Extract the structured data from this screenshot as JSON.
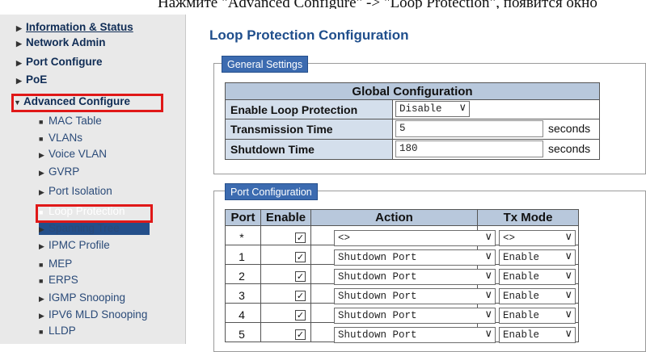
{
  "caption": "Нажмите \"Advanced Configure\" -> \"Loop Protection\", появится окно",
  "sidebar": {
    "items": [
      {
        "label": "Information & Status",
        "expander": "▶",
        "top": true
      },
      {
        "label": "Network Admin",
        "expander": "▶",
        "top": true
      },
      {
        "label": "Port Configure",
        "expander": "▶",
        "top": true
      },
      {
        "label": "PoE",
        "expander": "▶",
        "top": true
      },
      {
        "label": "Advanced Configure",
        "expander": "▼",
        "top": true
      },
      {
        "label": "MAC Table",
        "expander": "■"
      },
      {
        "label": "VLANs",
        "expander": "■"
      },
      {
        "label": "Voice VLAN",
        "expander": "▶"
      },
      {
        "label": "GVRP",
        "expander": "▶"
      },
      {
        "label": "Port Isolation",
        "expander": "▶"
      },
      {
        "label": "Loop Protection",
        "expander": "■"
      },
      {
        "label": "Spanning Tree",
        "expander": "▶"
      },
      {
        "label": "IPMC Profile",
        "expander": "▶"
      },
      {
        "label": "MEP",
        "expander": "■"
      },
      {
        "label": "ERPS",
        "expander": "■"
      },
      {
        "label": "IGMP Snooping",
        "expander": "▶"
      },
      {
        "label": "IPV6 MLD Snooping",
        "expander": "▶"
      },
      {
        "label": "LLDP",
        "expander": "■"
      }
    ],
    "highlight_color": "#e01818",
    "selected_color": "#244f8a"
  },
  "page_title": "Loop Protection Configuration",
  "general": {
    "legend": "General Settings",
    "header": "Global Configuration",
    "rows": [
      {
        "label": "Enable Loop Protection",
        "value": "Disable"
      },
      {
        "label": "Transmission Time",
        "value": "5",
        "unit": "seconds"
      },
      {
        "label": "Shutdown Time",
        "value": "180",
        "unit": "seconds"
      }
    ]
  },
  "port": {
    "legend": "Port Configuration",
    "headers": {
      "port": "Port",
      "enable": "Enable",
      "action": "Action",
      "txmode": "Tx Mode"
    },
    "rows": [
      {
        "port": "*",
        "enable": "checked",
        "action": "<>",
        "txmode": "<>"
      },
      {
        "port": "1",
        "enable": "checked",
        "action": "Shutdown Port",
        "txmode": "Enable"
      },
      {
        "port": "2",
        "enable": "checked",
        "action": "Shutdown Port",
        "txmode": "Enable"
      },
      {
        "port": "3",
        "enable": "checked",
        "action": "Shutdown Port",
        "txmode": "Enable"
      },
      {
        "port": "4",
        "enable": "checked",
        "action": "Shutdown Port",
        "txmode": "Enable"
      },
      {
        "port": "5",
        "enable": "checked",
        "action": "Shutdown Port",
        "txmode": "Enable"
      }
    ]
  },
  "icons": {
    "check": "check-icon",
    "dropdown": "chevron-down-icon"
  },
  "colors": {
    "legend_bg": "#3c6bb0",
    "title": "#1f4e8c",
    "header_bg": "#b8c8dc",
    "label_bg": "#d4dfec"
  }
}
